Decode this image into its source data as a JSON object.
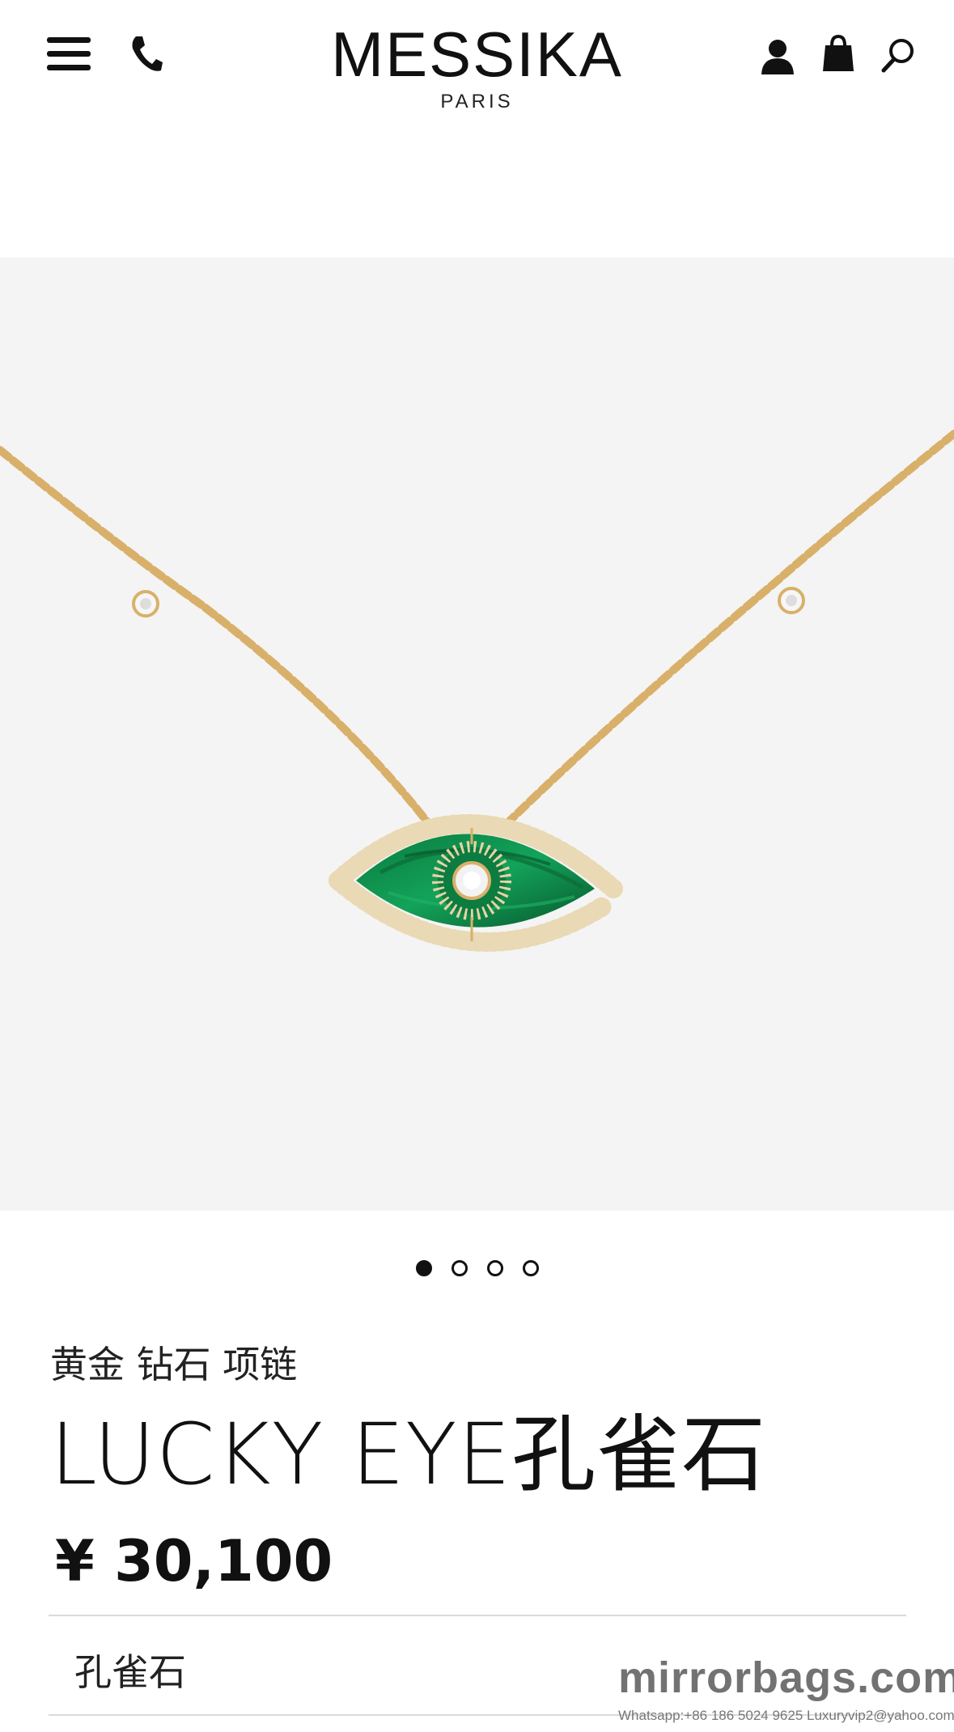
{
  "header": {
    "brand_name": "MESSIKA",
    "brand_sub": "PARIS",
    "icons": [
      "menu-icon",
      "phone-icon",
      "account-icon",
      "bag-icon",
      "search-icon"
    ]
  },
  "gallery": {
    "image": "necklace-lucky-eye-malachite",
    "dots": [
      {
        "active": true
      },
      {
        "active": false
      },
      {
        "active": false
      },
      {
        "active": false
      }
    ]
  },
  "product": {
    "category": "黄金 钻石 项链",
    "title": "LUCKY EYE孔雀石",
    "price": "¥ 30,100",
    "variant": "孔雀石"
  },
  "watermark": {
    "text": "mirrorbags.com",
    "contact": "Whatsapp:+86 186 5024 9625    Luxuryvip2@yahoo.com"
  },
  "colors": {
    "gallery_bg": "#f4f4f4",
    "gold": "#d9b06a",
    "malachite": "#0e8a49"
  }
}
